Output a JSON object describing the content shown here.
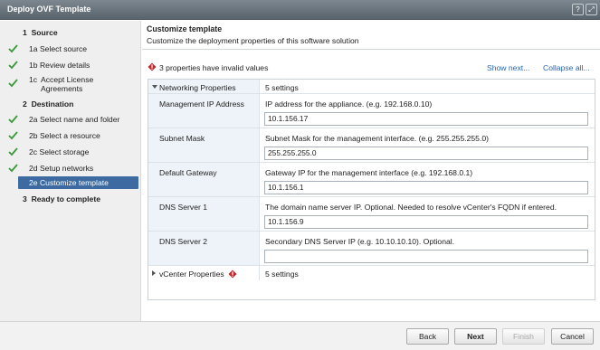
{
  "window": {
    "title": "Deploy OVF Template",
    "help_glyph": "?",
    "expand_glyph": "⤢"
  },
  "sidebar": {
    "steps": [
      {
        "number": "1",
        "label": "Source",
        "type": "head"
      },
      {
        "number": "1a",
        "label": "Select source",
        "done": true
      },
      {
        "number": "1b",
        "label": "Review details",
        "done": true
      },
      {
        "number": "1c",
        "label": "Accept License Agreements",
        "done": true
      },
      {
        "number": "2",
        "label": "Destination",
        "type": "head"
      },
      {
        "number": "2a",
        "label": "Select name and folder",
        "done": true
      },
      {
        "number": "2b",
        "label": "Select a resource",
        "done": true
      },
      {
        "number": "2c",
        "label": "Select storage",
        "done": true
      },
      {
        "number": "2d",
        "label": "Setup networks",
        "done": true
      },
      {
        "number": "2e",
        "label": "Customize template",
        "active": true
      },
      {
        "number": "3",
        "label": "Ready to complete",
        "type": "head"
      }
    ]
  },
  "header": {
    "title": "Customize template",
    "subtitle": "Customize the deployment properties of this software solution"
  },
  "warning": {
    "text": "3 properties have invalid values",
    "icon": "warning-icon",
    "color": "#c0272d"
  },
  "links": {
    "show_next": "Show next...",
    "collapse_all": "Collapse all..."
  },
  "sections": [
    {
      "name": "Networking Properties",
      "count": "5 settings",
      "expanded": true,
      "properties": [
        {
          "name": "Management IP Address",
          "description": "IP address for the appliance. (e.g. 192.168.0.10)",
          "value": "10.1.156.17"
        },
        {
          "name": "Subnet Mask",
          "description": "Subnet Mask for the management interface. (e.g. 255.255.255.0)",
          "value": "255.255.255.0"
        },
        {
          "name": "Default Gateway",
          "description": "Gateway IP for the management interface (e.g. 192.168.0.1)",
          "value": "10.1.156.1"
        },
        {
          "name": "DNS Server 1",
          "description": "The domain name server IP. Optional. Needed to resolve vCenter's FQDN if entered.",
          "value": "10.1.156.9"
        },
        {
          "name": "DNS Server 2",
          "description": "Secondary DNS Server IP (e.g. 10.10.10.10). Optional.",
          "value": ""
        }
      ]
    },
    {
      "name": "vCenter Properties",
      "count": "5 settings",
      "expanded": false,
      "has_warning": true
    }
  ],
  "footer": {
    "back": "Back",
    "next": "Next",
    "finish": "Finish",
    "cancel": "Cancel"
  },
  "colors": {
    "accent": "#3c6aa1",
    "link": "#2466b2",
    "check": "#3a9a3a",
    "titlebar": "#6b747c"
  }
}
